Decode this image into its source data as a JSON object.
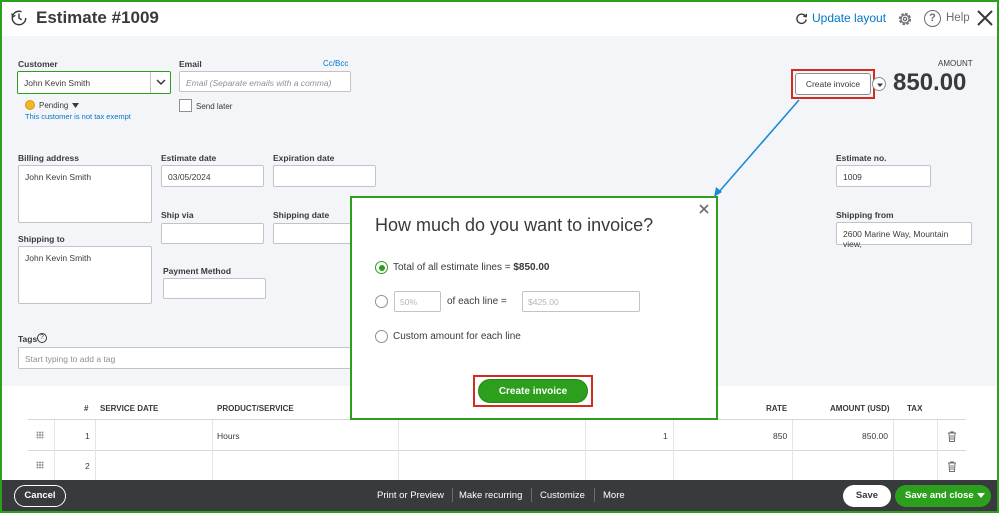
{
  "header": {
    "title": "Estimate #1009",
    "update_layout": "Update layout",
    "help": "Help"
  },
  "form": {
    "customer_label": "Customer",
    "customer_value": "John Kevin Smith",
    "email_label": "Email",
    "email_placeholder": "Email (Separate emails with a comma)",
    "cc_bcc": "Cc/Bcc",
    "send_later": "Send later",
    "status": "Pending",
    "tax_note": "This customer is not tax exempt",
    "amount_label": "AMOUNT",
    "amount_value": "850.00",
    "create_invoice": "Create invoice",
    "billing_address_label": "Billing address",
    "billing_address_value": "John Kevin Smith",
    "estimate_date_label": "Estimate date",
    "estimate_date_value": "03/05/2024",
    "expiration_date_label": "Expiration date",
    "estimate_no_label": "Estimate no.",
    "estimate_no_value": "1009",
    "ship_via_label": "Ship via",
    "shipping_date_label": "Shipping date",
    "shipping_from_label": "Shipping from",
    "shipping_from_value": "2600 Marine Way, Mountain view,",
    "shipping_to_label": "Shipping to",
    "shipping_to_value": "John Kevin Smith",
    "payment_method_label": "Payment Method",
    "tags_label": "Tags",
    "tags_placeholder": "Start typing to add a tag"
  },
  "table": {
    "headers": {
      "num": "#",
      "service_date": "SERVICE DATE",
      "product": "PRODUCT/SERVICE",
      "rate": "RATE",
      "amount": "AMOUNT (USD)",
      "tax": "TAX"
    },
    "rows": [
      {
        "num": "1",
        "product": "Hours",
        "qty": "1",
        "rate": "850",
        "amount": "850.00"
      },
      {
        "num": "2",
        "product": "",
        "qty": "",
        "rate": "",
        "amount": ""
      }
    ]
  },
  "modal": {
    "title": "How much do you want to invoice?",
    "option1_prefix": "Total of all estimate lines = ",
    "option1_amount": "$850.00",
    "option2_percent_placeholder": "50%",
    "option2_text": "of each line =",
    "option2_amount_placeholder": "$425.00",
    "option3": "Custom amount for each line",
    "button": "Create invoice"
  },
  "footer": {
    "cancel": "Cancel",
    "print_preview": "Print or Preview",
    "make_recurring": "Make recurring",
    "customize": "Customize",
    "more": "More",
    "save": "Save",
    "save_close": "Save and close"
  },
  "colors": {
    "accent_green": "#2ca01c",
    "link_blue": "#0077c5",
    "highlight_red": "#d52b1e",
    "footer_bg": "#393a3d"
  }
}
